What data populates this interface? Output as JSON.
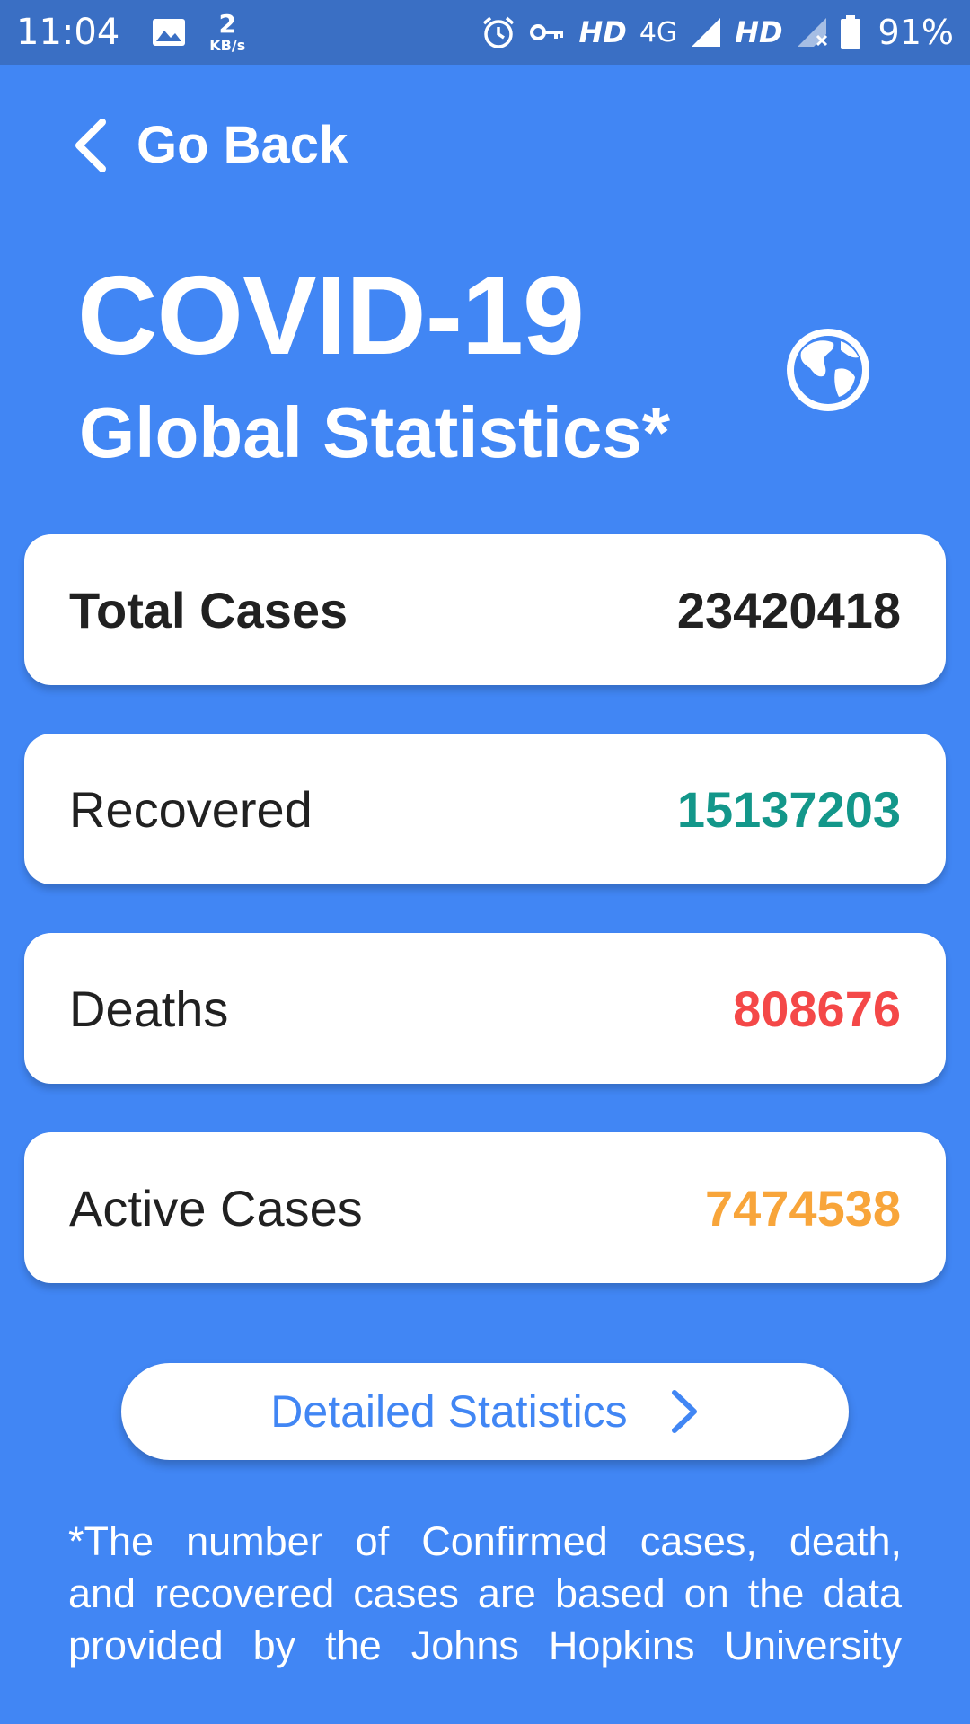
{
  "status_bar": {
    "time": "11:04",
    "net_speed_value": "2",
    "net_speed_unit": "KB/s",
    "hd1": "HD",
    "network": "4G",
    "hd2": "HD",
    "battery": "91%"
  },
  "nav": {
    "back_label": "Go Back"
  },
  "header": {
    "title": "COVID-19",
    "subtitle": "Global Statistics*",
    "icon": "globe-icon"
  },
  "stats": [
    {
      "label": "Total Cases",
      "value": "23420418",
      "color": "#212121"
    },
    {
      "label": "Recovered",
      "value": "15137203",
      "color": "#13978a"
    },
    {
      "label": "Deaths",
      "value": "808676",
      "color": "#f44848"
    },
    {
      "label": "Active Cases",
      "value": "7474538",
      "color": "#f8a53a"
    }
  ],
  "detail_button": {
    "label": "Detailed Statistics"
  },
  "footnote": {
    "line1": "*The number of Confirmed cases, death,",
    "line2": "and recovered cases are based on the data",
    "line3": "provided by the Johns Hopkins University"
  },
  "colors": {
    "background": "#4186f4",
    "status_bar": "#3a6fc4",
    "accent": "#4186f4"
  }
}
